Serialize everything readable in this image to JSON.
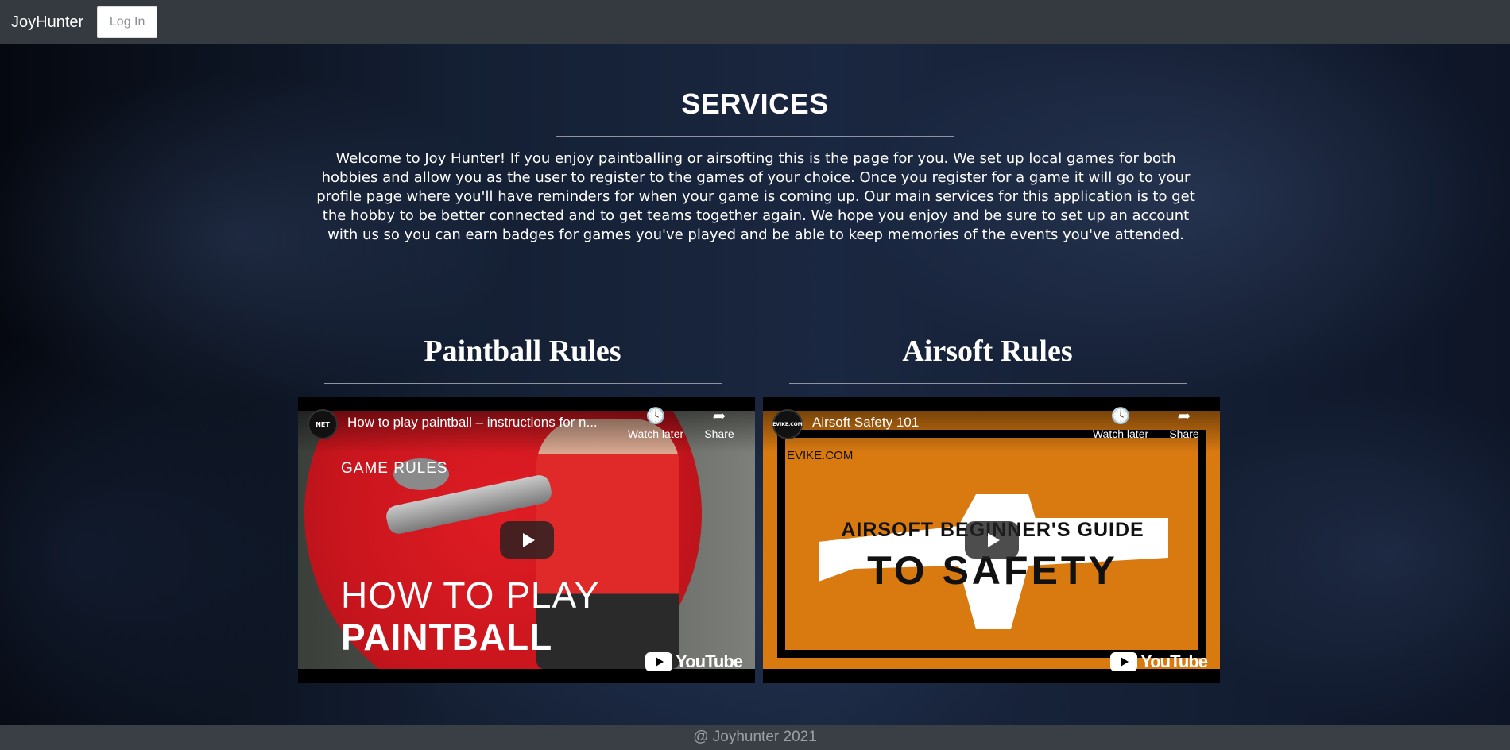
{
  "nav": {
    "brand": "JoyHunter",
    "login_label": "Log In"
  },
  "services": {
    "title": "SERVICES",
    "intro": "Welcome to Joy Hunter! If you enjoy paintballing or airsofting this is the page for you. We set up local games for both hobbies and allow you as the user to register to the games of your choice. Once you register for a game it will go to your profile page where you'll have reminders for when your game is coming up. Our main services for this application is to get the hobby to be better connected and to get teams together again. We hope you enjoy and be sure to set up an account with us so you can earn badges for games you've played and be able to keep memories of the events you've attended."
  },
  "columns": [
    {
      "title": "Paintball Rules",
      "video": {
        "channel_logo_text": "NET",
        "title": "How to play paintball – instructions for n...",
        "watch_later": "Watch later",
        "share": "Share",
        "youtube": "YouTube",
        "thumb_label_small": "GAME RULES",
        "thumb_label_line1": "HOW TO PLAY",
        "thumb_label_line2": "PAINTBALL"
      }
    },
    {
      "title": "Airsoft Rules",
      "video": {
        "channel_logo_text": "EVIKE.COM",
        "title": "Airsoft Safety 101",
        "watch_later": "Watch later",
        "share": "Share",
        "youtube": "YouTube",
        "thumb_logo": "EVIKE.COM",
        "thumb_label_line1": "AIRSOFT BEGINNER'S GUIDE",
        "thumb_label_line2": "TO SAFETY"
      }
    }
  ],
  "footer": {
    "text": "@ Joyhunter 2021"
  },
  "colors": {
    "navbar": "#343a40",
    "footer": "#3a3f45",
    "paintball_red": "#e01c24",
    "airsoft_orange": "#d97a11"
  }
}
